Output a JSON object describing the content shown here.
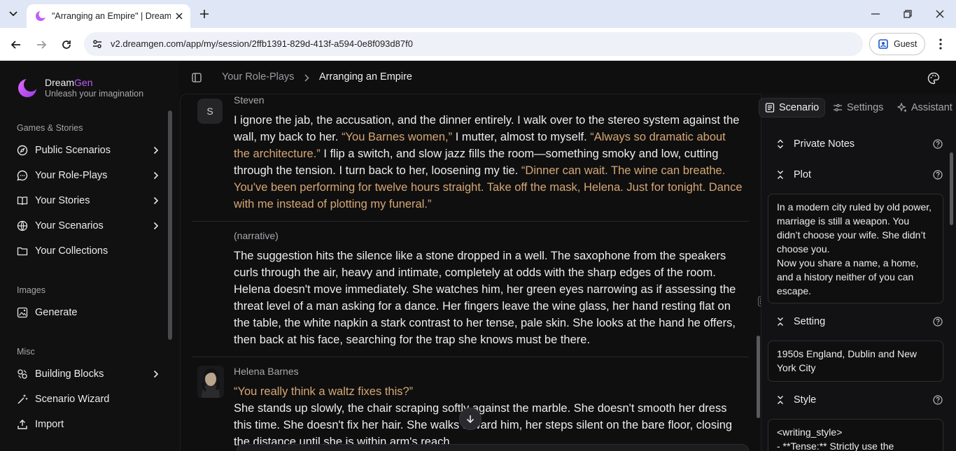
{
  "browser": {
    "tab_title": "\"Arranging an Empire\" | DreamGen",
    "url": "v2.dreamgen.com/app/my/session/2ffb1391-829d-413f-a594-0e8f093d87f0",
    "profile_label": "Guest"
  },
  "sidebar": {
    "brand_name_a": "Dream",
    "brand_name_b": "Gen",
    "tagline": "Unleash your imagination",
    "sections": [
      {
        "label": "Games & Stories"
      },
      {
        "label": "Images"
      },
      {
        "label": "Misc"
      }
    ],
    "items": [
      {
        "label": "Public Scenarios",
        "icon": "compass-icon"
      },
      {
        "label": "Your Role-Plays",
        "icon": "chat-bubble-icon"
      },
      {
        "label": "Your Stories",
        "icon": "book-icon"
      },
      {
        "label": "Your Scenarios",
        "icon": "globe-icon"
      },
      {
        "label": "Your Collections",
        "icon": "folder-icon"
      },
      {
        "label": "Generate",
        "icon": "image-generate-icon"
      },
      {
        "label": "Building Blocks",
        "icon": "blocks-icon"
      },
      {
        "label": "Scenario Wizard",
        "icon": "magic-wand-icon"
      },
      {
        "label": "Import",
        "icon": "upload-icon"
      }
    ]
  },
  "header": {
    "crumb_parent": "Your Role-Plays",
    "crumb_current": "Arranging an Empire"
  },
  "chat": {
    "messages": [
      {
        "author": "Steven",
        "avatar_letter": "S",
        "segments": [
          {
            "t": "I ignore the jab, the accusation, and the dinner entirely. I walk over to the stereo system against the wall, my back to her. ",
            "q": false
          },
          {
            "t": "“You Barnes women,”",
            "q": true
          },
          {
            "t": " I mutter, almost to myself. ",
            "q": false
          },
          {
            "t": "“Always so dramatic about the architecture.”",
            "q": true
          },
          {
            "t": " I flip a switch, and slow jazz fills the room—something smoky and low, cutting through the tension. I turn back to her, loosening my tie. ",
            "q": false
          },
          {
            "t": "“Dinner can wait. The wine can breathe. You've been performing for twelve hours straight. Take off the mask, Helena. Just for tonight. Dance with me instead of plotting my funeral.”",
            "q": true
          }
        ]
      },
      {
        "author": "(narrative)",
        "segments": [
          {
            "t": "The suggestion hits the silence like a stone dropped in a well. The saxophone from the speakers curls through the air, heavy and intimate, completely at odds with the sharp edges of the room. Helena doesn't move immediately. She watches him, her green eyes narrowing as if assessing the threat level of a man asking for a dance. Her fingers leave the wine glass, her hand resting flat on the table, the white napkin a stark contrast to her tense, pale skin. She looks at the hand he offers, then back at his face, searching for the trap she knows must be there.",
            "q": false
          }
        ]
      },
      {
        "author": "Helena Barnes",
        "quote_line": "“You really think a waltz fixes this?”",
        "segments": [
          {
            "t": "She stands up slowly, the chair scraping softly against the marble. She doesn't smooth her dress this time. She doesn't fix her hair. She walks toward him, her steps silent on the bare floor, closing the distance until she is within arm's reach.",
            "q": false
          }
        ]
      }
    ]
  },
  "panel": {
    "tabs": [
      {
        "label": "Scenario",
        "icon": "document-icon"
      },
      {
        "label": "Settings",
        "icon": "sliders-icon"
      },
      {
        "label": "Assistant",
        "icon": "sparkle-icon"
      }
    ],
    "sections": {
      "private_notes": "Private Notes",
      "plot": "Plot",
      "setting": "Setting",
      "style": "Style"
    },
    "plot_text": "In a modern city ruled by old power, marriage is still a weapon. You didn’t choose your wife. She didn’t choose you.\nNow you share a name, a home, and a history neither of you can escape.",
    "setting_text": "1950s England, Dublin and New York City",
    "style_text": "<writing_style>\n- **Tense:** Strictly use the"
  },
  "colors": {
    "accent": "#c05cf7",
    "quote": "#d6a773",
    "background": "#0f0f10"
  }
}
